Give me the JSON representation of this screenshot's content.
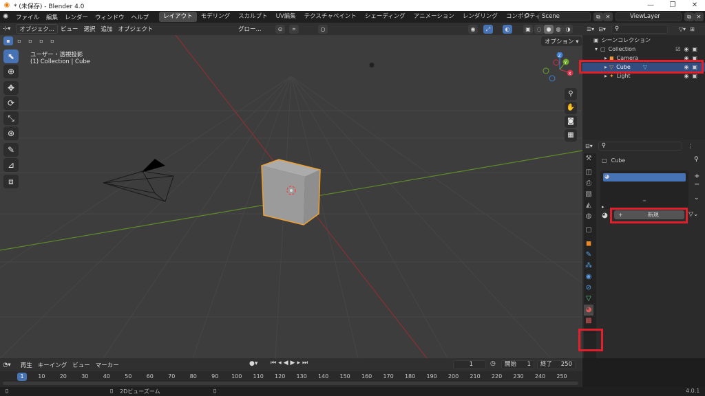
{
  "window": {
    "title": "* (未保存) - Blender 4.0",
    "minimize": "—",
    "maximize": "❐",
    "close": "✕"
  },
  "menu": {
    "items": [
      "ファイル",
      "編集",
      "レンダー",
      "ウィンドウ",
      "ヘルプ"
    ],
    "workspaces": [
      "レイアウト",
      "モデリング",
      "スカルプト",
      "UV編集",
      "テクスチャペイント",
      "シェーディング",
      "アニメーション",
      "レンダリング",
      "コンポジティング"
    ],
    "active_workspace": "レイアウト",
    "scene": "Scene",
    "view_layer": "ViewLayer"
  },
  "viewport_header": {
    "mode": "オブジェク...",
    "menus": [
      "ビュー",
      "選択",
      "追加",
      "オブジェクト"
    ],
    "transform": "グロー...",
    "options": "オプション"
  },
  "viewport": {
    "view_name": "ユーザー・透視投影",
    "collection_info": "(1) Collection | Cube",
    "gizmo_axes": [
      "Z",
      "Y",
      "X"
    ]
  },
  "outliner": {
    "root": "シーンコレクション",
    "collection": "Collection",
    "items": [
      {
        "name": "Camera"
      },
      {
        "name": "Cube",
        "selected": true
      },
      {
        "name": "Light"
      }
    ]
  },
  "properties": {
    "object_name": "Cube",
    "new_button": "新規",
    "plus_label": "+",
    "active_tab_color": "#e0202c"
  },
  "timeline": {
    "menus": [
      "再生",
      "キーイング",
      "ビュー",
      "マーカー"
    ],
    "current_frame": "1",
    "start_label": "開始",
    "start": "1",
    "end_label": "終了",
    "end": "250",
    "frames": [
      "1",
      "10",
      "20",
      "30",
      "40",
      "50",
      "60",
      "70",
      "80",
      "90",
      "100",
      "110",
      "120",
      "130",
      "140",
      "150",
      "160",
      "170",
      "180",
      "190",
      "200",
      "210",
      "220",
      "230",
      "240",
      "250"
    ]
  },
  "statusbar": {
    "hint": "2Dビューズーム",
    "version": "4.0.1"
  },
  "colors": {
    "accent": "#4772b3",
    "highlight": "#e0202c",
    "selection_outline": "#f0a030"
  }
}
